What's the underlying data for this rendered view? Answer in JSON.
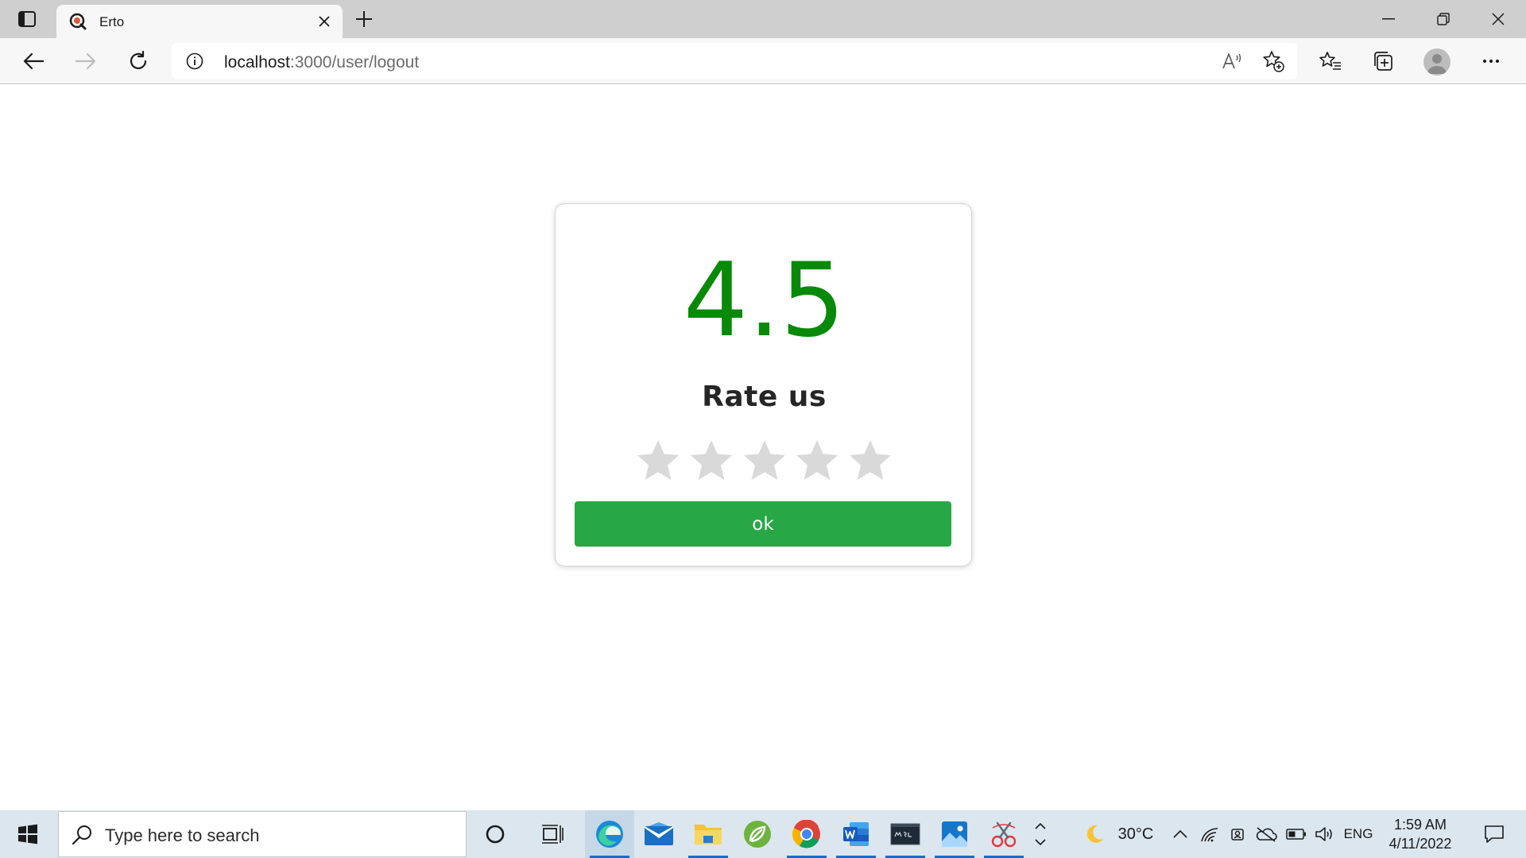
{
  "browser": {
    "tab": {
      "title": "Erto",
      "favicon": "erto-logo-icon"
    },
    "address": {
      "host": "localhost",
      "rest": ":3000/user/logout"
    },
    "icons": {
      "tab_actions": "tab-actions-icon",
      "close_tab": "close-icon",
      "new_tab": "plus-icon",
      "minimize": "minimize-icon",
      "restore": "restore-icon",
      "close_window": "close-icon",
      "back": "back-arrow-icon",
      "forward": "forward-arrow-icon",
      "refresh": "refresh-icon",
      "site_info": "info-icon",
      "read_aloud": "read-aloud-icon",
      "add_favorite": "add-favorite-icon",
      "favorites": "favorites-icon",
      "collections": "collections-icon",
      "profile": "avatar",
      "more": "more-icon"
    }
  },
  "rating_card": {
    "score": "4.5",
    "title": "Rate us",
    "stars_total": 5,
    "stars_selected": 0,
    "button_label": "ok",
    "colors": {
      "score": "#088a08",
      "button": "#28a745",
      "star": "#d9d9d9"
    }
  },
  "taskbar": {
    "search_placeholder": "Type here to search",
    "apps": [
      "cortana",
      "task-view",
      "edge",
      "mail",
      "file-explorer",
      "spring-tools",
      "chrome",
      "word",
      "mysql",
      "photos",
      "snipping-tool"
    ],
    "weather": {
      "icon": "moon-icon",
      "temperature": "30°C"
    },
    "language": "ENG",
    "time": "1:59 AM",
    "date": "4/11/2022"
  }
}
